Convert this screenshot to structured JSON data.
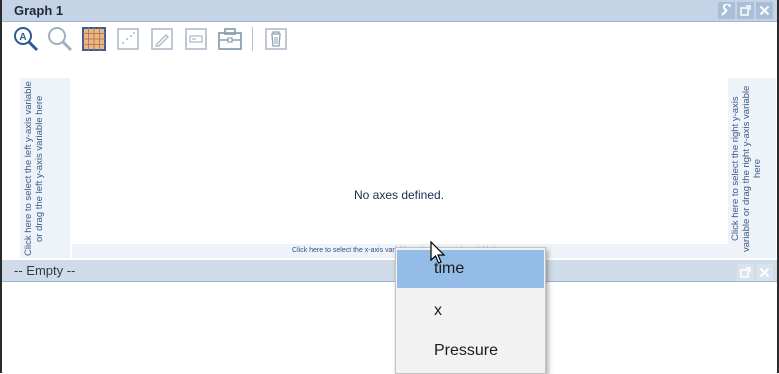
{
  "graph_panel": {
    "title": "Graph 1",
    "left_axis_hint": "Click here to select the left y-axis variable or drag the left y-axis variable here",
    "right_axis_hint": "Click here to select the right y-axis variable or drag the right y-axis variable here",
    "x_axis_hint": "Click here to select the x-axis variable or drag the x-axis variable here",
    "message": "No axes defined."
  },
  "toolbar": {
    "icons": [
      "zoom-axes-icon",
      "zoom-icon",
      "grid-icon",
      "scatter-icon",
      "edit-icon",
      "legend-icon",
      "toolbox-icon",
      "delete-icon"
    ]
  },
  "empty_panel": {
    "title": "-- Empty --"
  },
  "context_menu": {
    "items": [
      "time",
      "x",
      "Pressure"
    ],
    "selected": "time"
  },
  "colors": {
    "title_bar": "#c4d4e6",
    "menu_highlight": "#93bde6",
    "axis_zone": "#eef3f9",
    "hint_text": "#3a5a86"
  }
}
